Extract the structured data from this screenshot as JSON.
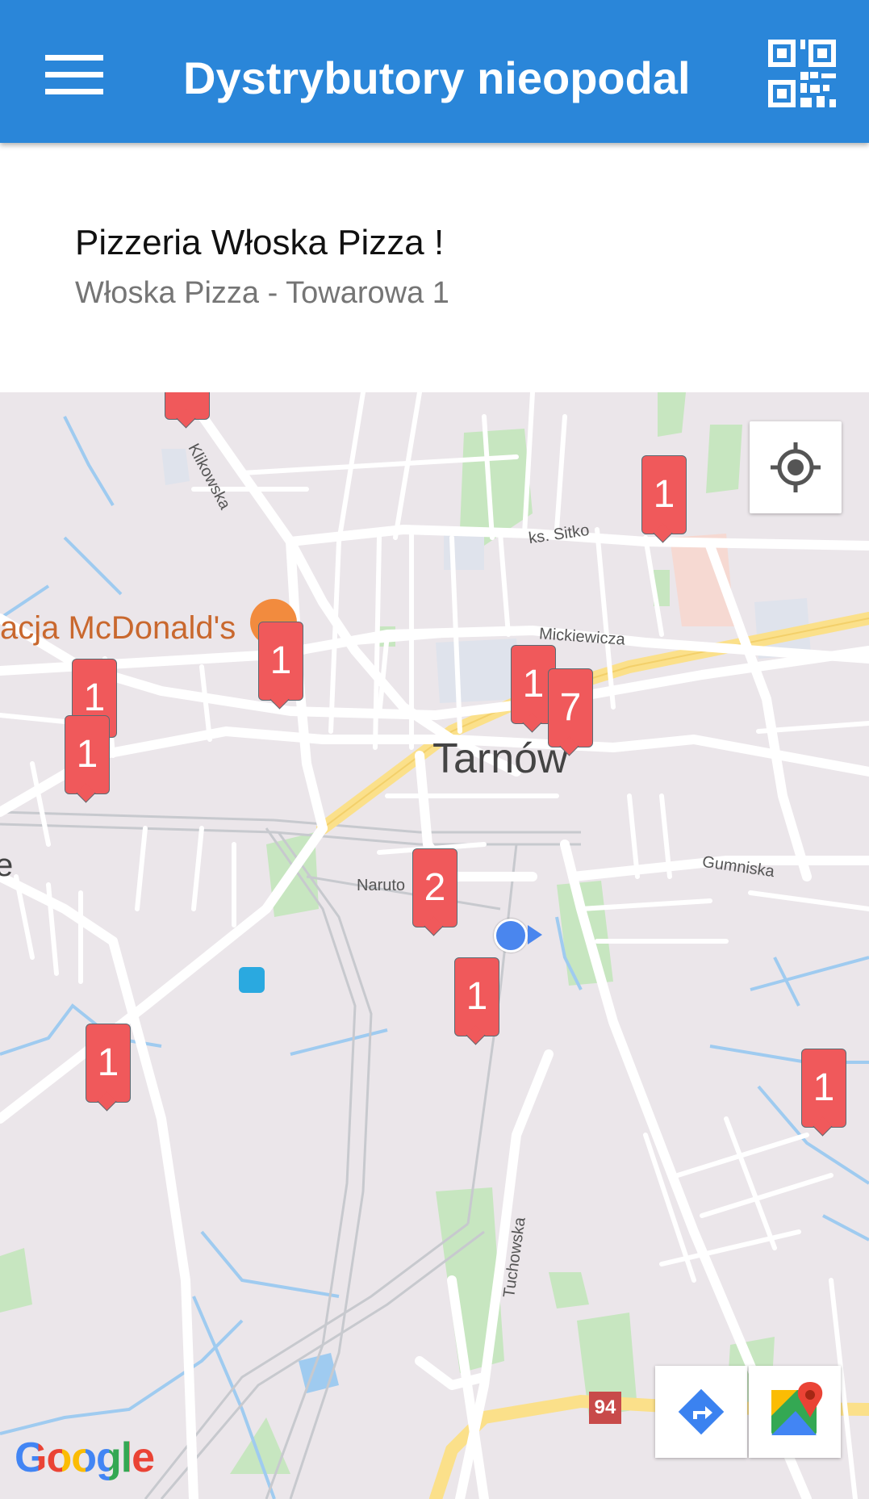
{
  "appbar": {
    "title": "Dystrybutory nieopodal",
    "menu_icon": "hamburger-menu-icon",
    "qr_icon": "qr-code-icon",
    "color": "#2a86d9"
  },
  "card": {
    "title": "Pizzeria Włoska Pizza !",
    "subtitle": "Włoska Pizza - Towarowa 1"
  },
  "map": {
    "city_label": "Tarnów",
    "poi_label": "acja McDonald's",
    "edge_letter": "e",
    "streets": {
      "klikowska": "Klikowska",
      "sitko": "ks. Sitko",
      "mickiewicza": "Mickiewicza",
      "gumniska": "Gumniska",
      "naruto": "Naruto",
      "tuchowska": "Tuchowska"
    },
    "road_number": "94",
    "google_logo": "Google",
    "markers": [
      "1",
      "1",
      "1",
      "1",
      "1",
      "7",
      "1",
      "2",
      "1",
      "1",
      "1"
    ],
    "marker_color": "#f0595b"
  },
  "buttons": {
    "locate_icon": "my-location-icon",
    "directions_icon": "directions-icon",
    "maps_icon": "google-maps-icon"
  }
}
